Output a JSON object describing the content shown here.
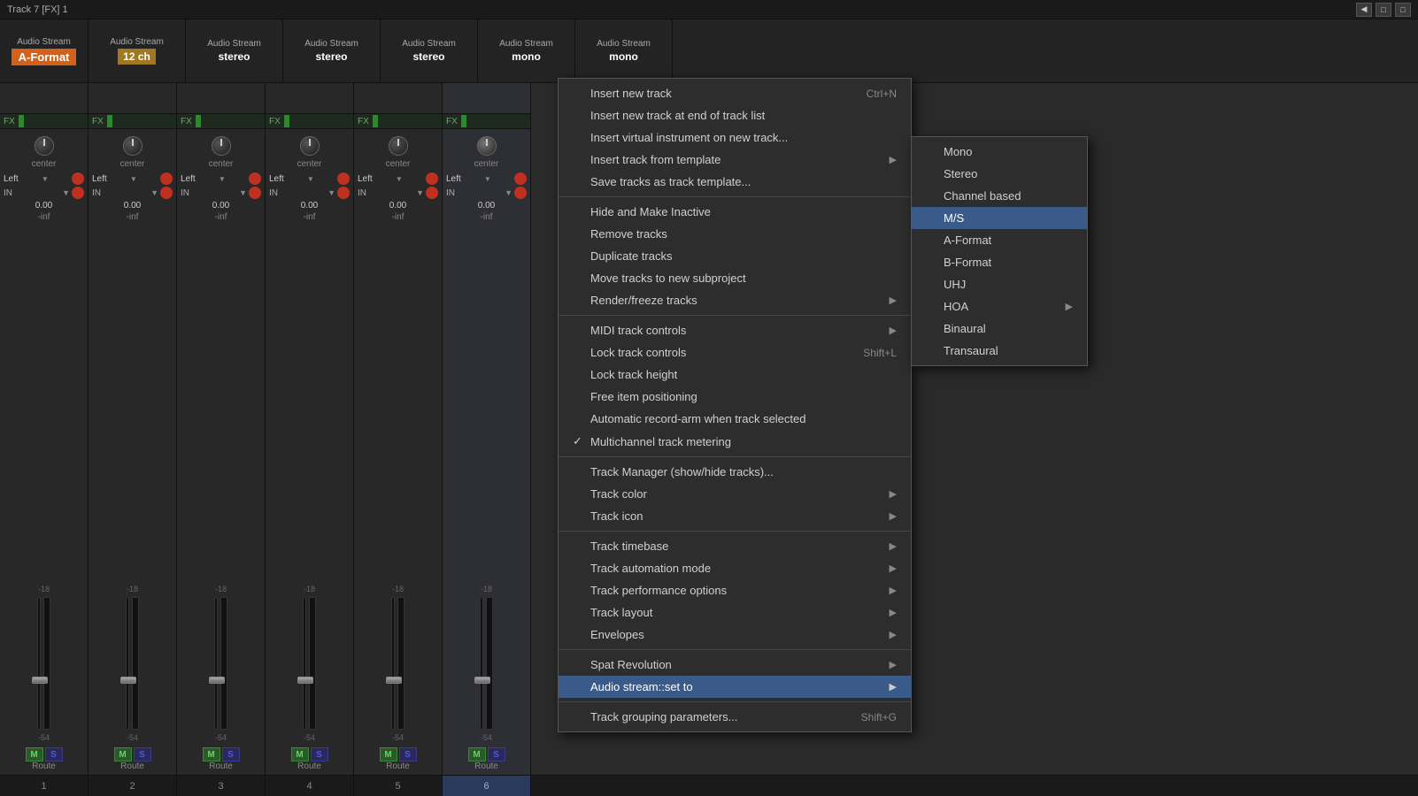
{
  "topbar": {
    "title": "Track 7 [FX] 1",
    "nav_prev": "◀",
    "nav_btns": "□□"
  },
  "track_headers": [
    {
      "label": "Audio Stream",
      "value": "A-Format",
      "style": "orange"
    },
    {
      "label": "Audio Stream",
      "value": "12 ch",
      "style": "yellow"
    },
    {
      "label": "Audio Stream",
      "value": "stereo",
      "style": "normal"
    },
    {
      "label": "Audio Stream",
      "value": "stereo",
      "style": "normal"
    },
    {
      "label": "Audio Stream",
      "value": "stereo",
      "style": "normal"
    },
    {
      "label": "Audio Stream",
      "value": "mono",
      "style": "normal"
    },
    {
      "label": "Audio Stream",
      "value": "mono",
      "style": "normal"
    }
  ],
  "channels": [
    {
      "number": "1",
      "pan": "center",
      "routing": "Left",
      "db": "0.00",
      "db2": "-inf",
      "active": false
    },
    {
      "number": "2",
      "pan": "center",
      "routing": "Left",
      "db": "0.00",
      "db2": "-inf",
      "active": false
    },
    {
      "number": "3",
      "pan": "center",
      "routing": "Left",
      "db": "0.00",
      "db2": "-inf",
      "active": false
    },
    {
      "number": "4",
      "pan": "center",
      "routing": "Left",
      "db": "0.00",
      "db2": "-inf",
      "active": false
    },
    {
      "number": "5",
      "pan": "center",
      "routing": "Left",
      "db": "0.00",
      "db2": "-inf",
      "active": false
    },
    {
      "number": "6",
      "pan": "center",
      "routing": "Left",
      "db": "0.00",
      "db2": "-inf",
      "active": true
    }
  ],
  "context_menu": {
    "items": [
      {
        "id": "insert-new-track",
        "label": "Insert new track",
        "shortcut": "Ctrl+N",
        "has_sub": false,
        "check": ""
      },
      {
        "id": "insert-at-end",
        "label": "Insert new track at end of track list",
        "shortcut": "",
        "has_sub": false,
        "check": ""
      },
      {
        "id": "insert-vsti",
        "label": "Insert virtual instrument on new track...",
        "shortcut": "",
        "has_sub": false,
        "check": ""
      },
      {
        "id": "insert-from-template",
        "label": "Insert track from template",
        "shortcut": "",
        "has_sub": true,
        "check": ""
      },
      {
        "id": "save-template",
        "label": "Save tracks as track template...",
        "shortcut": "",
        "has_sub": false,
        "check": ""
      },
      {
        "id": "sep1",
        "type": "separator"
      },
      {
        "id": "hide-inactive",
        "label": "Hide and Make Inactive",
        "shortcut": "",
        "has_sub": false,
        "check": ""
      },
      {
        "id": "remove-tracks",
        "label": "Remove tracks",
        "shortcut": "",
        "has_sub": false,
        "check": ""
      },
      {
        "id": "duplicate-tracks",
        "label": "Duplicate tracks",
        "shortcut": "",
        "has_sub": false,
        "check": ""
      },
      {
        "id": "move-tracks-subproject",
        "label": "Move tracks to new subproject",
        "shortcut": "",
        "has_sub": false,
        "check": ""
      },
      {
        "id": "render-freeze",
        "label": "Render/freeze tracks",
        "shortcut": "",
        "has_sub": true,
        "check": ""
      },
      {
        "id": "sep2",
        "type": "separator"
      },
      {
        "id": "midi-controls",
        "label": "MIDI track controls",
        "shortcut": "",
        "has_sub": true,
        "check": ""
      },
      {
        "id": "lock-controls",
        "label": "Lock track controls",
        "shortcut": "Shift+L",
        "has_sub": false,
        "check": ""
      },
      {
        "id": "lock-height",
        "label": "Lock track height",
        "shortcut": "",
        "has_sub": false,
        "check": ""
      },
      {
        "id": "free-item",
        "label": "Free item positioning",
        "shortcut": "",
        "has_sub": false,
        "check": ""
      },
      {
        "id": "auto-record-arm",
        "label": "Automatic record-arm when track selected",
        "shortcut": "",
        "has_sub": false,
        "check": ""
      },
      {
        "id": "multichannel-metering",
        "label": "Multichannel track metering",
        "shortcut": "",
        "has_sub": false,
        "check": "✓"
      },
      {
        "id": "sep3",
        "type": "separator"
      },
      {
        "id": "track-manager",
        "label": "Track Manager (show/hide tracks)...",
        "shortcut": "",
        "has_sub": false,
        "check": ""
      },
      {
        "id": "track-color",
        "label": "Track color",
        "shortcut": "",
        "has_sub": true,
        "check": ""
      },
      {
        "id": "track-icon",
        "label": "Track icon",
        "shortcut": "",
        "has_sub": true,
        "check": ""
      },
      {
        "id": "sep4",
        "type": "separator"
      },
      {
        "id": "track-timebase",
        "label": "Track timebase",
        "shortcut": "",
        "has_sub": true,
        "check": ""
      },
      {
        "id": "track-automation-mode",
        "label": "Track automation mode",
        "shortcut": "",
        "has_sub": true,
        "check": ""
      },
      {
        "id": "track-performance-options",
        "label": "Track performance options",
        "shortcut": "",
        "has_sub": true,
        "check": ""
      },
      {
        "id": "track-layout",
        "label": "Track layout",
        "shortcut": "",
        "has_sub": true,
        "check": ""
      },
      {
        "id": "envelopes",
        "label": "Envelopes",
        "shortcut": "",
        "has_sub": true,
        "check": ""
      },
      {
        "id": "sep5",
        "type": "separator"
      },
      {
        "id": "spat-revolution",
        "label": "Spat Revolution",
        "shortcut": "",
        "has_sub": true,
        "check": ""
      },
      {
        "id": "audio-stream-set-to",
        "label": "Audio stream::set to",
        "shortcut": "",
        "has_sub": true,
        "check": "",
        "highlighted": true
      },
      {
        "id": "sep6",
        "type": "separator"
      },
      {
        "id": "track-grouping-params",
        "label": "Track grouping parameters...",
        "shortcut": "Shift+G",
        "has_sub": false,
        "check": ""
      }
    ]
  },
  "audio_stream_submenu": {
    "items": [
      {
        "id": "mono",
        "label": "Mono",
        "check": ""
      },
      {
        "id": "stereo",
        "label": "Stereo",
        "check": ""
      },
      {
        "id": "channel-based",
        "label": "Channel based",
        "check": ""
      },
      {
        "id": "ms",
        "label": "M/S",
        "check": "",
        "highlighted": true
      },
      {
        "id": "a-format",
        "label": "A-Format",
        "check": ""
      },
      {
        "id": "b-format",
        "label": "B-Format",
        "check": ""
      },
      {
        "id": "uhj",
        "label": "UHJ",
        "check": ""
      },
      {
        "id": "hoa",
        "label": "HOA",
        "has_sub": true,
        "check": ""
      },
      {
        "id": "binaural",
        "label": "Binaural",
        "check": ""
      },
      {
        "id": "transaural",
        "label": "Transaural",
        "check": ""
      }
    ]
  },
  "labels": {
    "fx": "FX",
    "route": "Route",
    "center": "center",
    "left": "Left",
    "in": "IN",
    "m": "M",
    "s": "S"
  }
}
